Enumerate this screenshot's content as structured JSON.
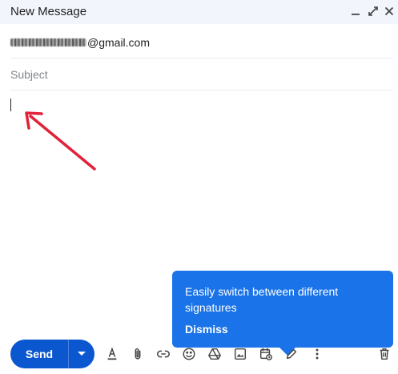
{
  "window": {
    "title": "New Message",
    "icons": [
      "minimize-icon",
      "popout-icon",
      "close-icon"
    ]
  },
  "recipient": {
    "email_suffix": "@gmail.com"
  },
  "subject": {
    "placeholder": "Subject"
  },
  "tooltip": {
    "message": "Easily switch between different signatures",
    "dismiss_label": "Dismiss"
  },
  "toolbar": {
    "send_label": "Send",
    "icons": [
      "text-format-icon",
      "attach-icon",
      "link-icon",
      "emoji-icon",
      "drive-icon",
      "photo-icon",
      "schedule-icon",
      "signature-icon",
      "more-options-icon",
      "trash-icon"
    ]
  },
  "colors": {
    "accent": "#1a73e8",
    "send_button": "#0b57d0",
    "header_bg": "#f2f6fc",
    "annotation_arrow": "#e0223a"
  }
}
